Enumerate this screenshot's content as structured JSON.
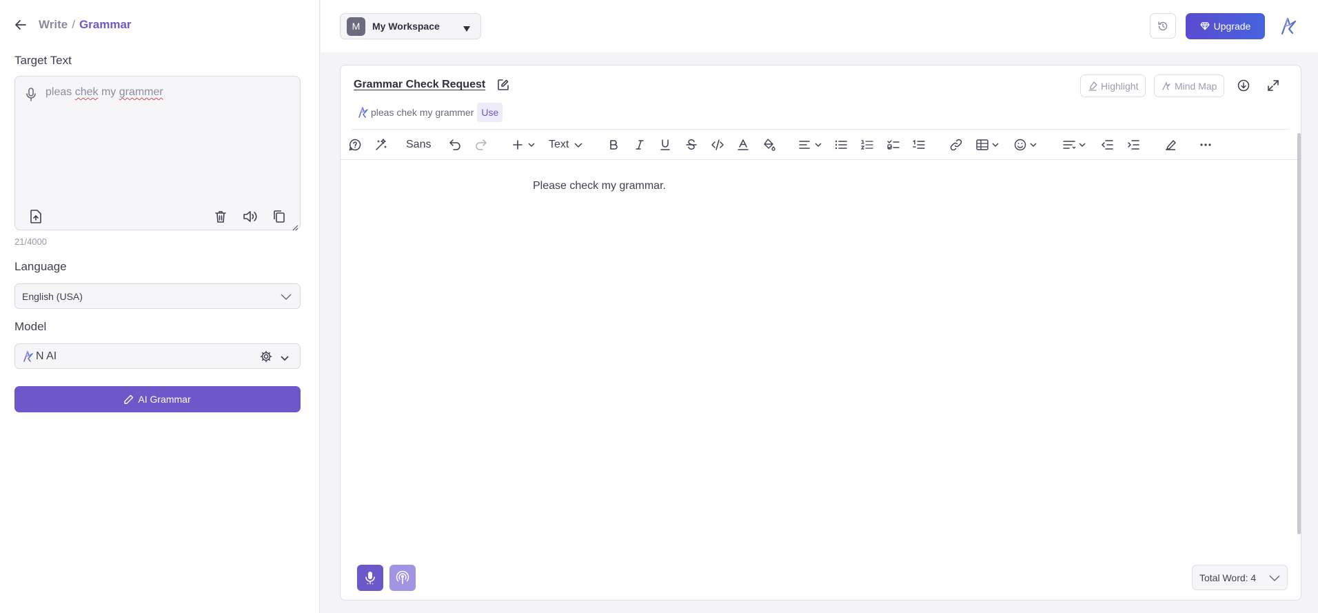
{
  "breadcrumb": {
    "parent": "Write",
    "separator": "/",
    "current": "Grammar"
  },
  "target_text": {
    "label": "Target Text",
    "value_parts": [
      "pleas ",
      "chek",
      " my ",
      "grammer"
    ],
    "counter": "21/4000"
  },
  "language": {
    "label": "Language",
    "selected": "English (USA)"
  },
  "model": {
    "label": "Model",
    "selected": "N AI"
  },
  "ai_grammar_button": "AI Grammar",
  "workspace": {
    "avatar": "M",
    "name": "My Workspace"
  },
  "upgrade_label": "Upgrade",
  "editor": {
    "title": "Grammar Check Request",
    "highlight_label": "Highlight",
    "mindmap_label": "Mind Map",
    "suggestion_text": "pleas chek my grammer",
    "use_label": "Use",
    "font_label": "Sans",
    "text_style_label": "Text",
    "content": "Please check my grammar.",
    "word_count": "Total Word: 4"
  },
  "colors": {
    "accent": "#6d58c9",
    "upgrade_gradient": [
      "#5b4bd0",
      "#4663de"
    ],
    "voice_button": "#a393e5"
  }
}
